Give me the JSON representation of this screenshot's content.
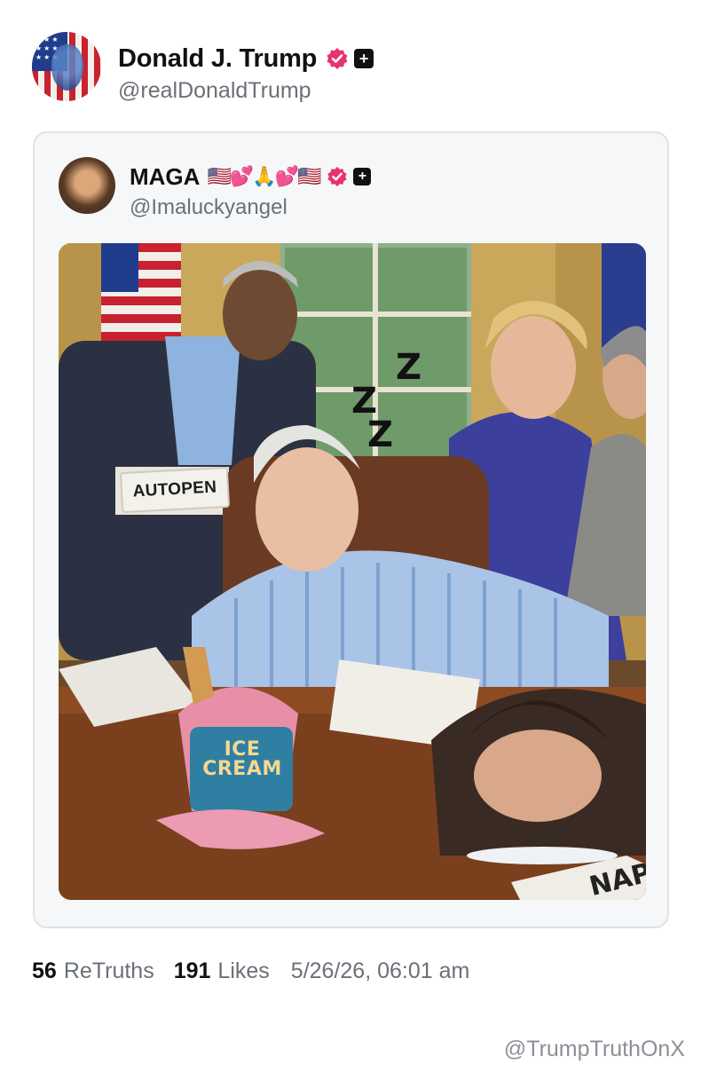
{
  "author": {
    "name": "Donald J. Trump",
    "handle": "@realDonaldTrump",
    "avatar": "avatar",
    "verified_icon": "verified-badge-icon",
    "plus_icon": "plus-icon"
  },
  "quoted_post": {
    "name": "MAGA",
    "name_emoji": "🇺🇸💕🙏💕🇺🇸",
    "handle": "@Imaluckyangel",
    "image": {
      "autopen_text": "AUTOPEN",
      "zzz": [
        "Z",
        "Z",
        "Z"
      ],
      "ice_cream_text_1": "ICE",
      "ice_cream_text_2": "CREAM",
      "newspaper_text": "NAP"
    }
  },
  "stats": {
    "retruths_count": "56",
    "retruths_label": "ReTruths",
    "likes_count": "191",
    "likes_label": "Likes",
    "timestamp": "5/26/26, 06:01 am"
  },
  "watermark": "@TrumpTruthOnX",
  "colors": {
    "verified": "#e8336e",
    "secondary_text": "#6b7077",
    "card_border": "#dfe2e6",
    "card_bg": "#f6f7f8"
  }
}
